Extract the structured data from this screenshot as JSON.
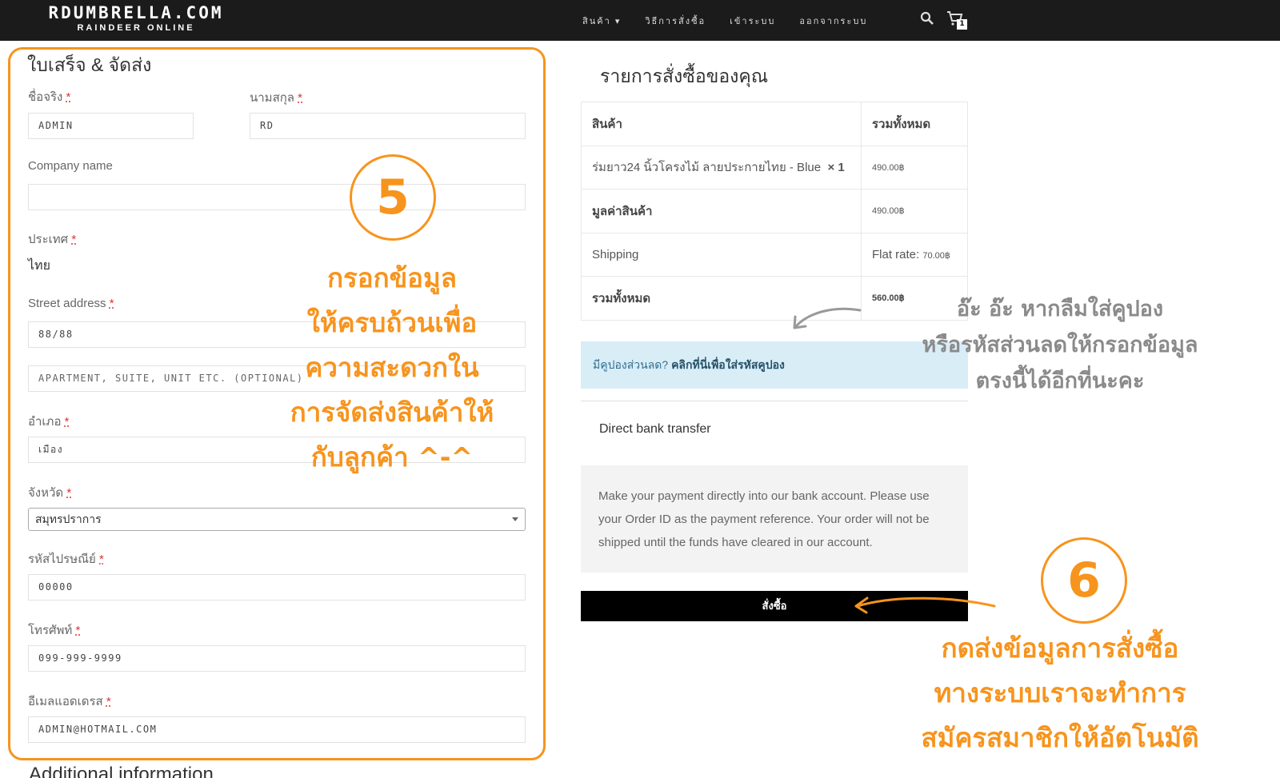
{
  "header": {
    "brand_name": "RDUMBRELLA.COM",
    "brand_tagline": "RAINDEER ONLINE",
    "nav": [
      "สินค้า ▾",
      "วิธีการสั่งซื้อ",
      "เข้าระบบ",
      "ออกจากระบบ"
    ],
    "cart_count": "1"
  },
  "billing": {
    "title": "ใบเสร็จ & จัดส่ง",
    "first_name_label": "ชื่อจริง",
    "first_name_value": "ADMIN",
    "last_name_label": "นามสกุล",
    "last_name_value": "RD",
    "company_label": "Company name",
    "company_value": "",
    "country_label": "ประเทศ",
    "country_value": "ไทย",
    "street_label": "Street address",
    "street_value": "88/88",
    "apartment_placeholder": "APARTMENT, SUITE, UNIT ETC. (OPTIONAL)",
    "district_label": "อำเภอ",
    "district_value": "เมือง",
    "province_label": "จังหวัด",
    "province_value": "สมุทรปราการ",
    "postcode_label": "รหัสไปรษณีย์",
    "postcode_value": "00000",
    "phone_label": "โทรศัพท์",
    "phone_value": "099-999-9999",
    "email_label": "อีเมลแอดเดรส",
    "email_value": "ADMIN@HOTMAIL.COM",
    "required_mark": "*",
    "additional_title": "Additional information"
  },
  "order": {
    "title": "รายการสั่งซื้อของคุณ",
    "col_product": "สินค้า",
    "col_total": "รวมทั้งหมด",
    "item_name": "ร่มยาว24 นิ้วโครงไม้ ลายประกายไทย - Blue",
    "item_qty": "× 1",
    "item_total": "490.00฿",
    "subtotal_label": "มูลค่าสินค้า",
    "subtotal_value": "490.00฿",
    "shipping_label": "Shipping",
    "shipping_method": "Flat rate: ",
    "shipping_value": "70.00฿",
    "total_label": "รวมทั้งหมด",
    "total_value": "560.00฿",
    "coupon_text": "มีคูปองส่วนลด? ",
    "coupon_link": "คลิกที่นี่เพื่อใส่รหัสคูปอง",
    "payment_method": "Direct bank transfer",
    "payment_desc": "Make your payment directly into our bank account. Please use your Order ID as the payment reference. Your order will not be shipped until the funds have cleared in our account.",
    "place_order": "สั่งซื้อ"
  },
  "annotations": {
    "step5": "5",
    "step5_lines": [
      "กรอกข้อมูล",
      "ให้ครบถ้วนเพื่อ",
      "ความสะดวกใน",
      "การจัดส่งสินค้าให้",
      "กับลูกค้า ^-^"
    ],
    "coupon_lines": [
      "อ๊ะ อ๊ะ หากลืมใส่คูปอง",
      "หรือรหัสส่วนลดให้กรอกข้อมูล",
      "ตรงนี้ได้อีกที่นะคะ"
    ],
    "step6": "6",
    "step6_lines": [
      "กดส่งข้อมูลการสั่งซื้อ",
      "ทางระบบเราจะทำการ",
      "สมัครสมาชิกให้อัตโนมัติ"
    ]
  },
  "colors": {
    "accent": "#f7941d",
    "nav_bg": "#1b1b1b",
    "coupon_bg": "#d9edf7",
    "button_bg": "#000000"
  }
}
